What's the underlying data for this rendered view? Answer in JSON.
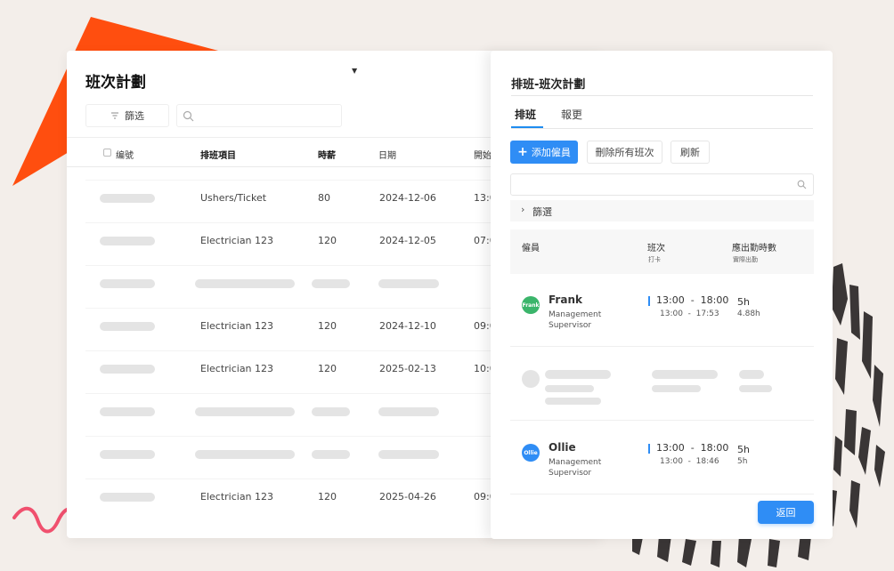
{
  "main": {
    "title": "班次計劃",
    "filter_label": "篩选",
    "search_value": "",
    "columns": {
      "id": "编號",
      "item": "排班項目",
      "wage": "時薪",
      "date": "日期",
      "start": "開始"
    },
    "rows": [
      {
        "item": "Ushers/Ticket",
        "wage": "80",
        "date": "2024-12-06",
        "start": "13:0"
      },
      {
        "item": "Electrician 123",
        "wage": "120",
        "date": "2024-12-05",
        "start": "07:0"
      },
      {
        "item": "",
        "wage": "",
        "date": "",
        "start": ""
      },
      {
        "item": "Electrician 123",
        "wage": "120",
        "date": "2024-12-10",
        "start": "09:0"
      },
      {
        "item": "Electrician 123",
        "wage": "120",
        "date": "2025-02-13",
        "start": "10:0"
      },
      {
        "item": "",
        "wage": "",
        "date": "",
        "start": ""
      },
      {
        "item": "",
        "wage": "",
        "date": "",
        "start": ""
      },
      {
        "item": "Electrician 123",
        "wage": "120",
        "date": "2025-04-26",
        "start": "09:0"
      }
    ]
  },
  "panel": {
    "title": "排班-班次計劃",
    "tabs": [
      "排班",
      "報更"
    ],
    "buttons": {
      "add": "添加僱員",
      "delete_all": "刪除所有班次",
      "refresh": "刷新",
      "back": "返回"
    },
    "search_value": "",
    "filter_label": "篩選",
    "table_header": {
      "employee": "僱員",
      "shift": "班次",
      "shift_sub": "打卡",
      "hours": "應出勤時數",
      "hours_sub": "實際出勤"
    },
    "employees": [
      {
        "avatar": "Frank",
        "avatar_color": "#3bb56b",
        "name": "Frank",
        "role": "Management Supervisor",
        "shift": "13:00  -  18:00",
        "clock": "13:00  -  17:53",
        "hours": "5h",
        "actual": "4.88h"
      },
      {
        "avatar": "Ollie",
        "avatar_color": "#2f8df5",
        "name": "Ollie",
        "role": "Management Supervisor",
        "shift": "13:00  -  18:00",
        "clock": "13:00  -  18:46",
        "hours": "5h",
        "actual": "5h"
      }
    ]
  },
  "colors": {
    "accent": "#2f8df5",
    "deco_orange": "#ff4e0f",
    "deco_pink": "#f0506e"
  }
}
